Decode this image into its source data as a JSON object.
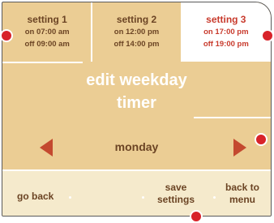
{
  "settings": [
    {
      "name": "setting 1",
      "on": "on 07:00 am",
      "off": "off 09:00 am",
      "selected": false
    },
    {
      "name": "setting 2",
      "on": "on 12:00 pm",
      "off": "off 14:00 pm",
      "selected": false
    },
    {
      "name": "setting 3",
      "on": "on 17:00 pm",
      "off": "off 19:00 pm",
      "selected": true
    }
  ],
  "title_line1": "edit weekday",
  "title_line2": "timer",
  "day": "monday",
  "bottom": {
    "go_back": "go back",
    "save_line1": "save",
    "save_line2": "settings",
    "menu_line1": "back to",
    "menu_line2": "menu"
  },
  "colors": {
    "panel": "#ebcd94",
    "bottom_bar": "#f5eacc",
    "text": "#6b4424",
    "selected_text": "#c83a2c",
    "arrow": "#c4492f",
    "marker": "#d8232a"
  },
  "icons": [
    "left-arrow-icon",
    "right-arrow-icon"
  ]
}
